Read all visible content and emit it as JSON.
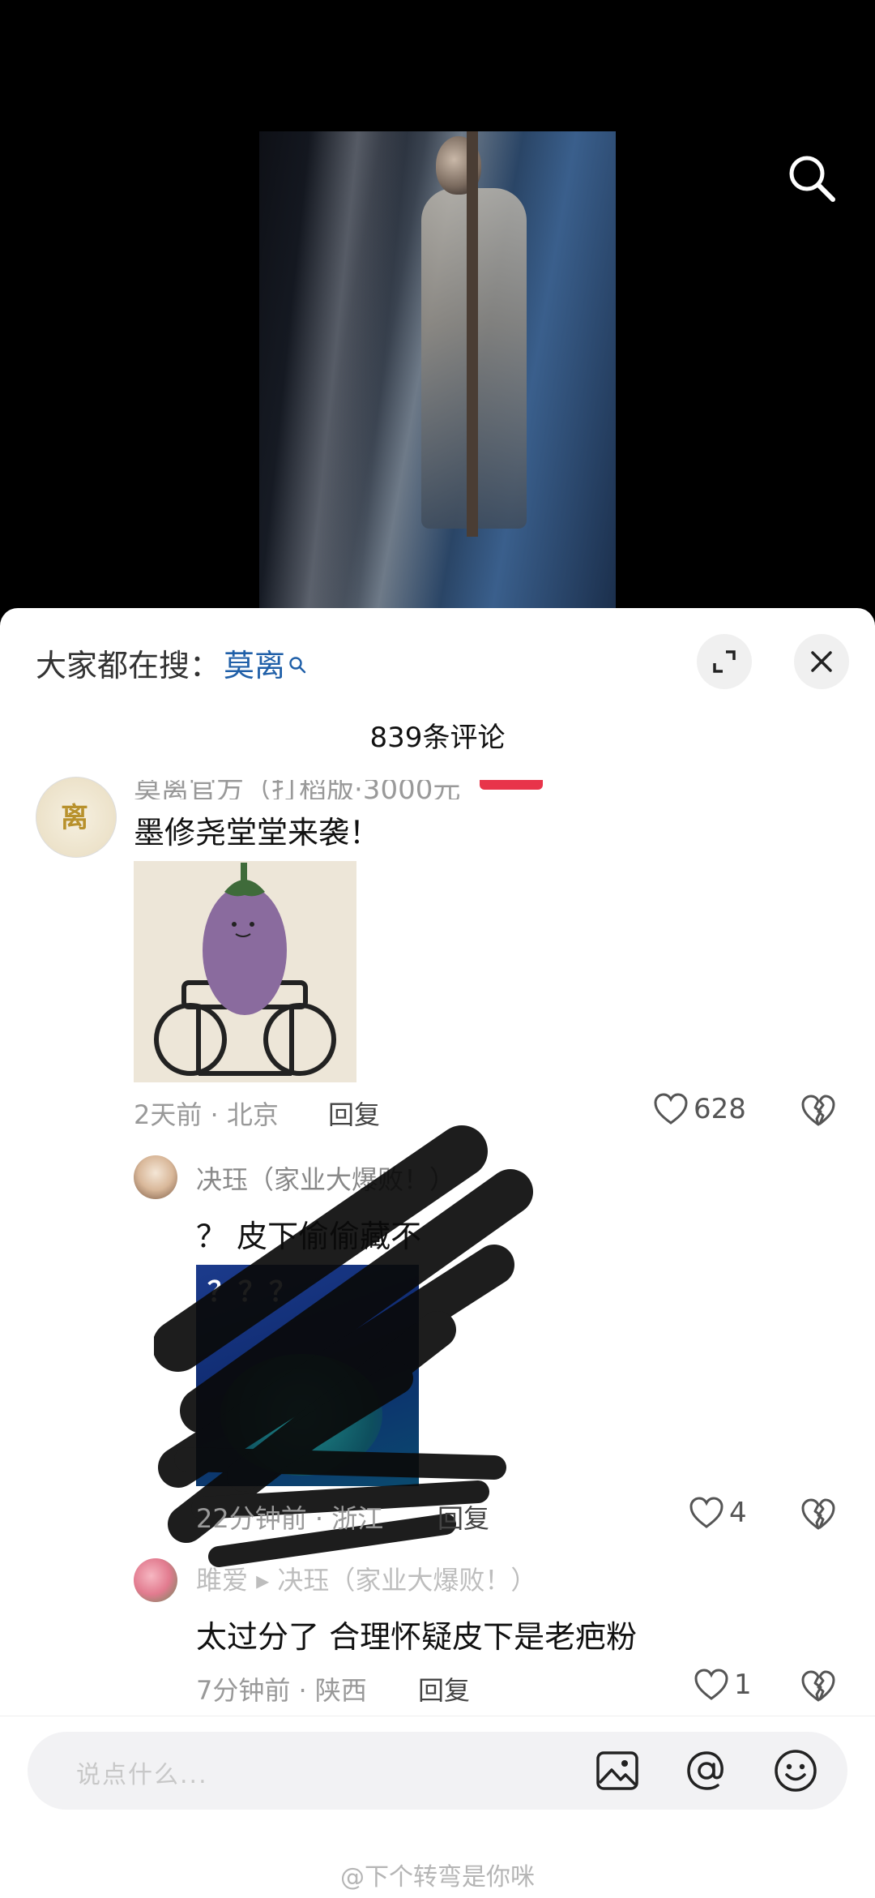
{
  "search": {
    "prefix": "大家都在搜：",
    "term": "莫离"
  },
  "comments_count": "839条评论",
  "comments": [
    {
      "name_partial": "莫离官方（打稻版·3000元",
      "text": "墨修尧堂堂来袭！",
      "meta": "2天前 · 北京",
      "reply": "回复",
      "likes": "628"
    },
    {
      "name": "决珏（家业大爆败！）",
      "text": "？ 皮下偷偷藏不",
      "image_text": "？？？",
      "meta": "22分钟前 · 浙江",
      "reply": "回复",
      "likes": "4"
    },
    {
      "name": "雎爱 ▸ 决珏（家业大爆败！）",
      "text": "太过分了 合理怀疑皮下是老疤粉",
      "meta": "7分钟前 · 陕西",
      "reply": "回复",
      "likes": "1"
    }
  ],
  "input": {
    "placeholder": "说点什么..."
  },
  "watermark": "@下个转弯是你咪",
  "icons": {
    "search": "search-icon",
    "expand": "expand-icon",
    "close": "close-icon",
    "heart": "heart-icon",
    "dislike": "broken-heart-icon",
    "image": "image-icon",
    "mention": "at-icon",
    "emoji": "emoji-icon"
  }
}
